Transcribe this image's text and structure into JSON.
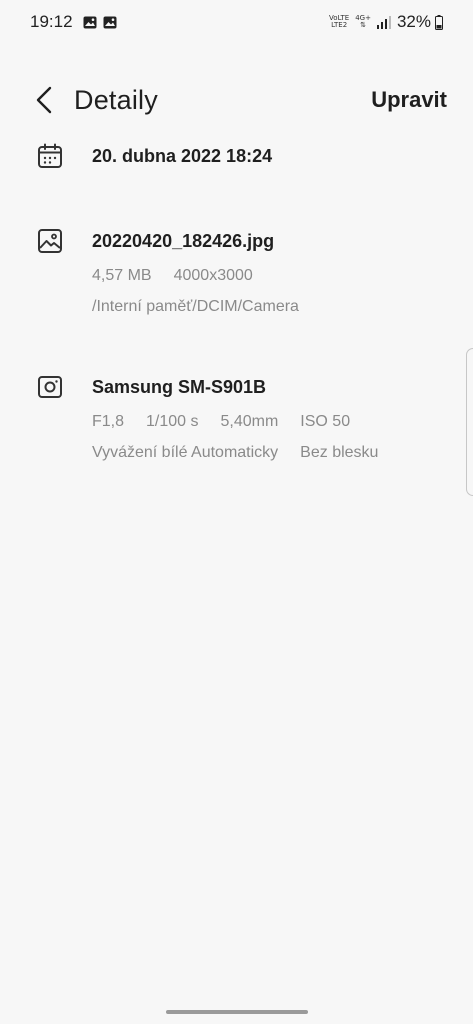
{
  "status_bar": {
    "time": "19:12",
    "network_top": "VoLTE",
    "network_bottom": "LTE2",
    "network_type": "4G+",
    "battery": "32%",
    "notification_icons": [
      "gallery-icon",
      "gallery-icon"
    ]
  },
  "header": {
    "title": "Detaily",
    "edit_label": "Upravit",
    "back_icon": "chevron-left-icon"
  },
  "date_section": {
    "icon": "calendar-icon",
    "value": "20. dubna 2022 18:24"
  },
  "file_section": {
    "icon": "image-icon",
    "filename": "20220420_182426.jpg",
    "size": "4,57 MB",
    "resolution": "4000x3000",
    "path": "/Interní paměť/DCIM/Camera"
  },
  "camera_section": {
    "icon": "camera-icon",
    "model": "Samsung SM-S901B",
    "aperture": "F1,8",
    "shutter": "1/100 s",
    "focal_length": "5,40mm",
    "iso": "ISO 50",
    "white_balance": "Vyvážení bílé Automaticky",
    "flash": "Bez blesku"
  }
}
